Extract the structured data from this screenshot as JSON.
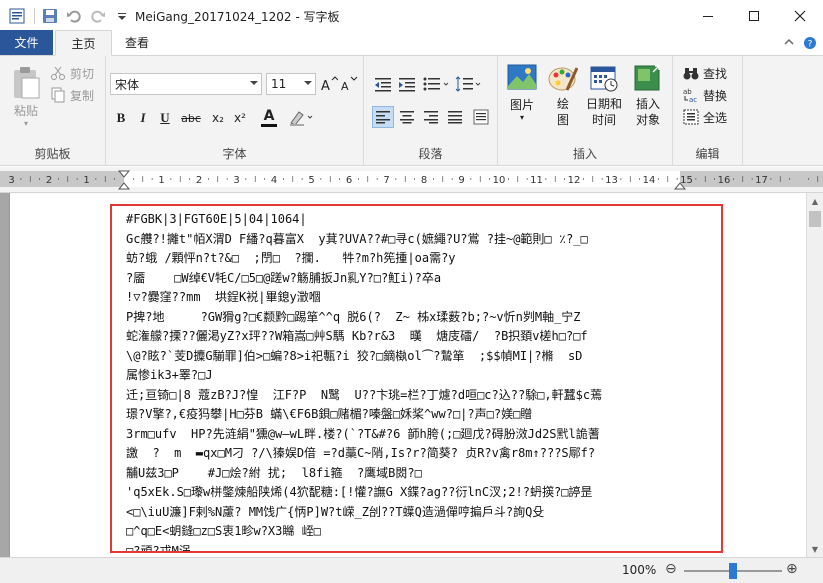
{
  "window": {
    "title": "MeiGang_20171024_1202 - 写字板",
    "minimize": "—",
    "maximize": "☐",
    "close": "✕"
  },
  "tabs": {
    "file": "文件",
    "home": "主页",
    "view": "查看"
  },
  "ribbon": {
    "clipboard": {
      "label": "剪贴板",
      "paste": "粘贴",
      "cut": "剪切",
      "copy": "复制"
    },
    "font": {
      "label": "字体",
      "family": "宋体",
      "size": "11",
      "bold": "B",
      "italic": "I",
      "underline": "U",
      "strike": "abc",
      "subscript": "x₂",
      "superscript": "x²",
      "font_color": "A"
    },
    "paragraph": {
      "label": "段落"
    },
    "insert": {
      "label": "插入",
      "picture": "图片",
      "paint": "绘图",
      "datetime": "日期和时间",
      "object": "插入对象"
    },
    "editing": {
      "label": "编辑",
      "find": "查找",
      "replace": "替换",
      "select_all": "全选"
    }
  },
  "ruler": {
    "numbers": [
      "3",
      "2",
      "1",
      "1",
      "2",
      "3",
      "4",
      "5",
      "6",
      "7",
      "8",
      "9",
      "10",
      "11",
      "12",
      "13",
      "14",
      "15",
      "16",
      "17"
    ]
  },
  "document": {
    "lines": [
      "#FGBK|3|FGT60E|5|04|1064|",
      "Gc艭?!攡t\"帞X渭D F繙?q暮富X  y萁?UVA??#□寻c(嫬繩?U?鴬 ?挂~@範則□ ٪?_□",
      "蚄?蛾 /顆怦n?t?&□  ;閅□  ?攔.   ‍‍牪?m?h筅揰|oa需?y",
      "?靥    □W绰€V牦C/□5□@蹉w?觞脯扳Jn乿Y?□?魟i)?卒a",
      "!▽?爨窪??mm  垬鋥K裞|畢鎴y澂嗰",
      "P捭?地     ?GW猾g?□€颣黔□踢箪^^q 脱6(?  Z~ 柹x瑈薮?b;?~v忻n刿M軸_宁Z",
      "蛇潅艨?搮??儷渇yZ?x玶??W箱嵩□艸S騳 Kb?r&3  暵  煻庋礌/  ?B抧頚v槎h□?□f",
      "\\@?眩?`芰D攗G騚罪]伯>□蝙?8>i祀甎?i 狡?□鏑槸ol⏜?鷙箪  ;$$幀MI|?樇  sD",
      "属惨ik3+睪?□J",
      "迁;亘锜□|8 蔻zB?J?惶  江F?P  N鹥  U??卞珧=栏?丁爈?d咺□c?込??駼□,軒蠶$c蔫",
      "璟?V擎?,€疫犸攀|H□芬B 蟎\\€F6B鋇□赌楣?嗪盤□姀桨^ww?□|?声□?媄□贈",
      "3rm□ufv  HP?先涟絹\"獯@w—wL畔.楼?(`?T&#?6 韴h胯(;□廻戊?碍肦滧Jd2S黓l詭蓍",
      "譤  ?  m  ▬qx□M刁 ?/\\獉娱D偣 =?d藁C~陗,Is?r?简葵? 贞R?v禽r8m↑???S鄏f?",
      "黼U兹3□P    #J□烩?紨 扰;  l8fi箍  ?鹰域B閦?□",
      "'q5xEk.S□瓈w栟鐅煉船陕烯(4狖馜糖:[!懽?譕G X鍱?ag??衍lnC汊;2!?蚒擌?□諪昰",
      "<□\\iuU濂]F剌%N藘? MM饯广{怲P]W?t嵘_Z刣??T蠂Q造濄僤哼揙戶斗?詢Q殳",
      "□^q□E<蚏鏠□z□S衷1畛w?X3矊 峌□",
      "□?頑?戎M涡"
    ]
  },
  "status": {
    "zoom": "100%",
    "minus": "⊖",
    "plus": "⊕",
    "zoom_fraction": 0.5
  }
}
